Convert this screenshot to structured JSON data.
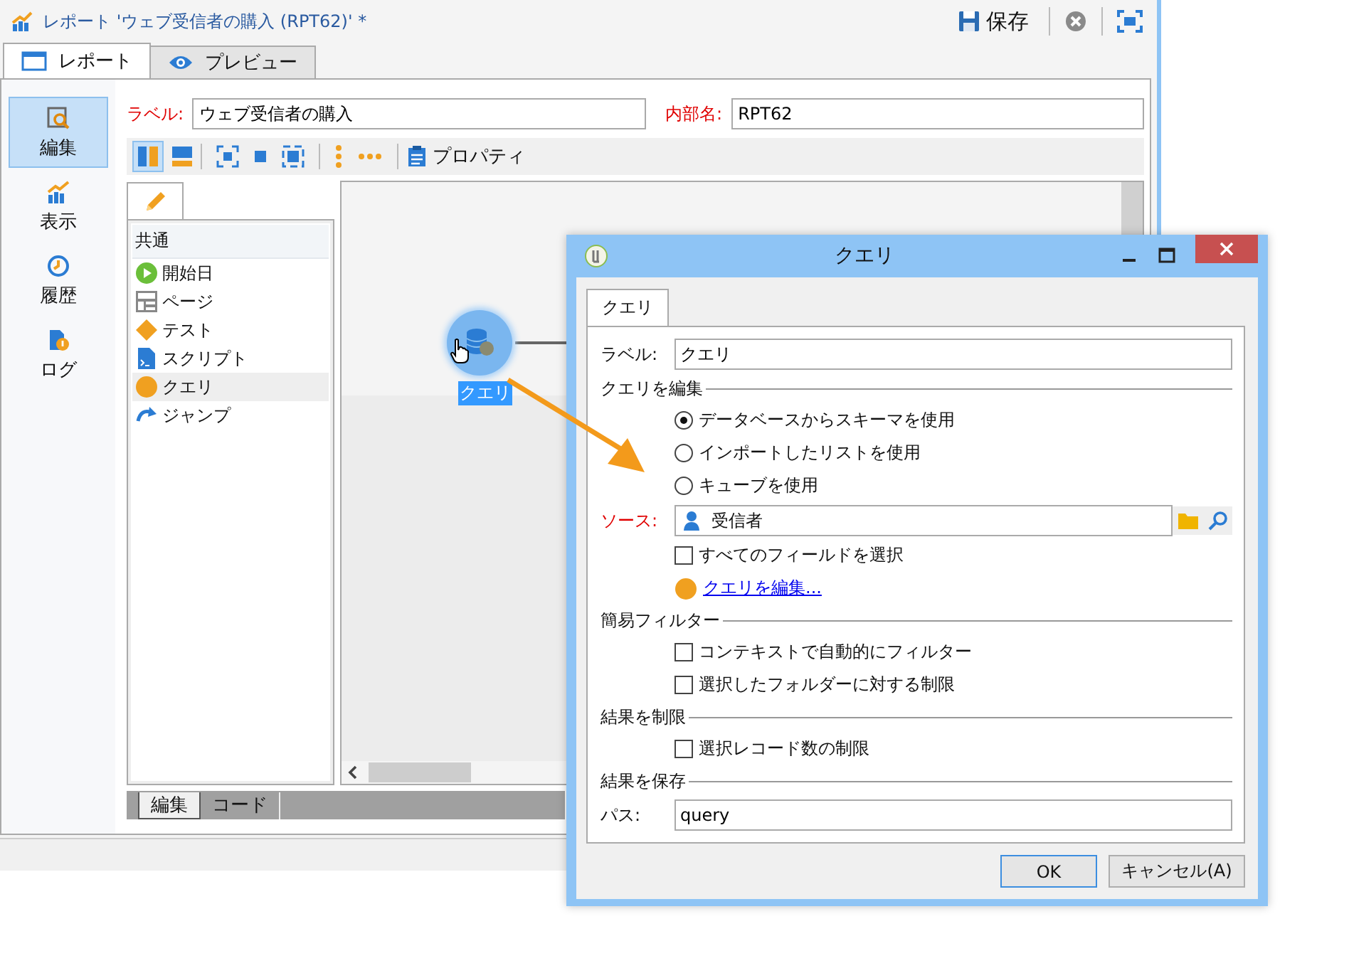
{
  "window": {
    "title": "レポート 'ウェブ受信者の購入 (RPT62)' *",
    "save_label": "保存"
  },
  "tabs": [
    {
      "label": "レポート",
      "selected": true
    },
    {
      "label": "プレビュー",
      "selected": false
    }
  ],
  "sidebar": {
    "items": [
      {
        "label": "編集",
        "selected": true
      },
      {
        "label": "表示",
        "selected": false
      },
      {
        "label": "履歴",
        "selected": false
      },
      {
        "label": "ログ",
        "selected": false
      }
    ]
  },
  "form": {
    "label_caption": "ラベル:",
    "label_value": "ウェブ受信者の購入",
    "internal_caption": "内部名:",
    "internal_value": "RPT62"
  },
  "toolbar": {
    "layout_buttons": [
      {
        "selected": true
      },
      {
        "selected": false
      }
    ],
    "properties_label": "プロパティ"
  },
  "palette": {
    "header": "共通",
    "items": [
      {
        "label": "開始日",
        "kind": "start",
        "selected": false
      },
      {
        "label": "ページ",
        "kind": "page",
        "selected": false
      },
      {
        "label": "テスト",
        "kind": "test",
        "selected": false
      },
      {
        "label": "スクリプト",
        "kind": "script",
        "selected": false
      },
      {
        "label": "クエリ",
        "kind": "query",
        "selected": true
      },
      {
        "label": "ジャンプ",
        "kind": "jump",
        "selected": false
      }
    ]
  },
  "canvas": {
    "node": {
      "label": "クエリ",
      "selected": true
    }
  },
  "editor_tabs": [
    {
      "label": "編集",
      "selected": true
    },
    {
      "label": "コード",
      "selected": false
    }
  ],
  "dialog": {
    "title": "クエリ",
    "tab": "クエリ",
    "label_caption": "ラベル:",
    "label_value": "クエリ",
    "sections": [
      {
        "title": "クエリを編集",
        "items": [
          {
            "kind": "radio",
            "label": "データベースからスキーマを使用",
            "selected": true
          },
          {
            "kind": "radio",
            "label": "インポートしたリストを使用",
            "selected": false
          },
          {
            "kind": "radio",
            "label": "キューブを使用",
            "selected": false
          },
          {
            "kind": "source",
            "caption": "ソース:",
            "value": "受信者"
          },
          {
            "kind": "checkbox",
            "label": "すべてのフィールドを選択",
            "checked": false
          },
          {
            "kind": "link",
            "label": "クエリを編集..."
          }
        ]
      },
      {
        "title": "簡易フィルター",
        "items": [
          {
            "kind": "checkbox",
            "label": "コンテキストで自動的にフィルター",
            "checked": false
          },
          {
            "kind": "checkbox",
            "label": "選択したフォルダーに対する制限",
            "checked": false
          }
        ]
      },
      {
        "title": "結果を制限",
        "items": [
          {
            "kind": "checkbox",
            "label": "選択レコード数の制限",
            "checked": false
          }
        ]
      },
      {
        "title": "結果を保存",
        "items": [
          {
            "kind": "field",
            "caption": "パス:",
            "value": "query"
          }
        ]
      }
    ],
    "buttons": [
      {
        "label": "OK",
        "default": true
      },
      {
        "label": "キャンセル(A)",
        "default": false
      }
    ]
  }
}
